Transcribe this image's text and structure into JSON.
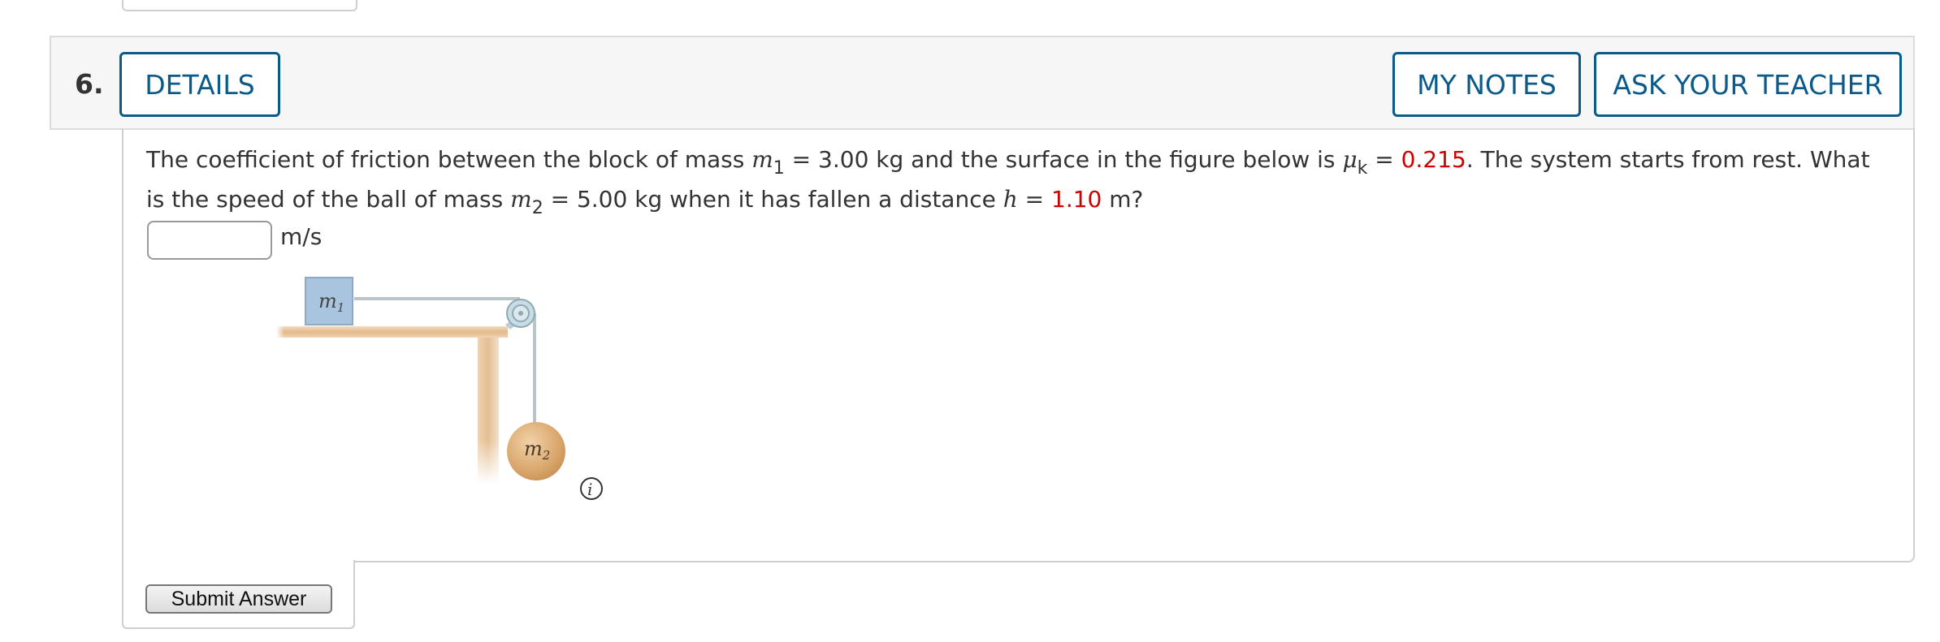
{
  "question": {
    "number": "6.",
    "header_buttons": {
      "details": "DETAILS",
      "my_notes": "MY NOTES",
      "ask_teacher": "ASK YOUR TEACHER"
    },
    "text": {
      "p1": "The coefficient of friction between the block of mass ",
      "m1_var": "m",
      "m1_sub": "1",
      "p2": " = 3.00 kg and the surface in the figure below is ",
      "mu_var": "μ",
      "mu_sub": "k",
      "p3": " = ",
      "mu_value": "0.215",
      "p4": ". The system starts from rest. What is the speed of the ball of mass ",
      "m2_var": "m",
      "m2_sub": "2",
      "p5": " = 5.00 kg when it has fallen a distance ",
      "h_var": "h",
      "p6": " = ",
      "h_value": "1.10",
      "p7": " m?"
    },
    "answer": {
      "value": "",
      "unit": "m/s"
    },
    "figure": {
      "block_label": "m",
      "block_sub": "1",
      "ball_label": "m",
      "ball_sub": "2",
      "info_icon": "info-icon"
    },
    "submit_label": "Submit Answer"
  },
  "colors": {
    "accent": "#0b5a8a",
    "given_value": "#d00000",
    "header_bg": "#f6f6f6"
  }
}
